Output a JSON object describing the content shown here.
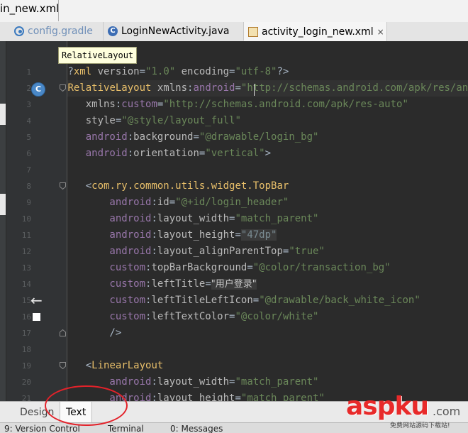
{
  "breadcrumb": {
    "file": "in_new.xml"
  },
  "tabs": [
    {
      "label": "config.gradle",
      "icon": "gradle-icon",
      "active": false
    },
    {
      "label": "LoginNewActivity.java",
      "icon": "java-class-icon",
      "icon_letter": "C",
      "active": false
    },
    {
      "label": "activity_login_new.xml",
      "icon": "xml-file-icon",
      "active": true,
      "close": "×"
    }
  ],
  "tooltip": "RelativeLayout",
  "gutter": {
    "class_marker": "C",
    "back_arrow": "←"
  },
  "lines": [
    {
      "n": "1",
      "segs": [
        [
          "punc",
          "<?"
        ],
        [
          "tag",
          "xml "
        ],
        [
          "attr",
          "version"
        ],
        [
          "punc",
          "="
        ],
        [
          "val",
          "\"1.0\""
        ],
        [
          "attr",
          " encoding"
        ],
        [
          "punc",
          "="
        ],
        [
          "val",
          "\"utf-8\""
        ],
        [
          "punc",
          "?>"
        ]
      ]
    },
    {
      "n": "2",
      "segs": [
        [
          "punc",
          "<"
        ],
        [
          "tag",
          "RelativeLayout "
        ],
        [
          "attr",
          "xmlns"
        ],
        [
          "punc",
          ":"
        ],
        [
          "ns",
          "android"
        ],
        [
          "punc",
          "="
        ],
        [
          "val",
          "\"http://schemas.android.com/apk/res/android\""
        ]
      ]
    },
    {
      "n": "3",
      "segs": [
        [
          "attr",
          "    xmlns"
        ],
        [
          "punc",
          ":"
        ],
        [
          "ns",
          "custom"
        ],
        [
          "punc",
          "="
        ],
        [
          "val",
          "\"http://schemas.android.com/apk/res-auto\""
        ]
      ]
    },
    {
      "n": "4",
      "segs": [
        [
          "attr",
          "    style"
        ],
        [
          "punc",
          "="
        ],
        [
          "val",
          "\"@style/layout_full\""
        ]
      ]
    },
    {
      "n": "5",
      "segs": [
        [
          "ns",
          "    android"
        ],
        [
          "punc",
          ":"
        ],
        [
          "attr",
          "background"
        ],
        [
          "punc",
          "="
        ],
        [
          "val",
          "\"@drawable/login_bg\""
        ]
      ]
    },
    {
      "n": "6",
      "segs": [
        [
          "ns",
          "    android"
        ],
        [
          "punc",
          ":"
        ],
        [
          "attr",
          "orientation"
        ],
        [
          "punc",
          "="
        ],
        [
          "val",
          "\"vertical\""
        ],
        [
          "punc",
          ">"
        ]
      ]
    },
    {
      "n": "7",
      "segs": []
    },
    {
      "n": "8",
      "segs": [
        [
          "punc",
          "    <"
        ],
        [
          "tag",
          "com.ry.common.utils.widget.TopBar"
        ]
      ]
    },
    {
      "n": "9",
      "segs": [
        [
          "ns",
          "        android"
        ],
        [
          "punc",
          ":"
        ],
        [
          "attr",
          "id"
        ],
        [
          "punc",
          "="
        ],
        [
          "val",
          "\"@+id/login_header\""
        ]
      ]
    },
    {
      "n": "10",
      "segs": [
        [
          "ns",
          "        android"
        ],
        [
          "punc",
          ":"
        ],
        [
          "attr",
          "layout_width"
        ],
        [
          "punc",
          "="
        ],
        [
          "val",
          "\"match_parent\""
        ]
      ]
    },
    {
      "n": "11",
      "segs": [
        [
          "ns",
          "        android"
        ],
        [
          "punc",
          ":"
        ],
        [
          "attr",
          "layout_height"
        ],
        [
          "punc",
          "="
        ],
        [
          "gray",
          "\"47dp\""
        ]
      ]
    },
    {
      "n": "12",
      "segs": [
        [
          "ns",
          "        android"
        ],
        [
          "punc",
          ":"
        ],
        [
          "attr",
          "layout_alignParentTop"
        ],
        [
          "punc",
          "="
        ],
        [
          "val",
          "\"true\""
        ]
      ]
    },
    {
      "n": "13",
      "segs": [
        [
          "ns",
          "        custom"
        ],
        [
          "punc",
          ":"
        ],
        [
          "attr",
          "topBarBackground"
        ],
        [
          "punc",
          "="
        ],
        [
          "val",
          "\"@color/transaction_bg\""
        ]
      ]
    },
    {
      "n": "14",
      "segs": [
        [
          "ns",
          "        custom"
        ],
        [
          "punc",
          ":"
        ],
        [
          "attr",
          "leftTitle"
        ],
        [
          "punc",
          "="
        ],
        [
          "zh",
          "\"用户登录\""
        ]
      ]
    },
    {
      "n": "15",
      "segs": [
        [
          "ns",
          "        custom"
        ],
        [
          "punc",
          ":"
        ],
        [
          "attr",
          "leftTitleLeftIcon"
        ],
        [
          "punc",
          "="
        ],
        [
          "val",
          "\"@drawable/back_white_icon\""
        ]
      ]
    },
    {
      "n": "16",
      "segs": [
        [
          "ns",
          "        custom"
        ],
        [
          "punc",
          ":"
        ],
        [
          "attr",
          "leftTextColor"
        ],
        [
          "punc",
          "="
        ],
        [
          "val",
          "\"@color/white\""
        ]
      ]
    },
    {
      "n": "17",
      "segs": [
        [
          "punc",
          "        />"
        ]
      ]
    },
    {
      "n": "18",
      "segs": []
    },
    {
      "n": "19",
      "segs": [
        [
          "punc",
          "    <"
        ],
        [
          "tag",
          "LinearLayout"
        ]
      ]
    },
    {
      "n": "20",
      "segs": [
        [
          "ns",
          "        android"
        ],
        [
          "punc",
          ":"
        ],
        [
          "attr",
          "layout_width"
        ],
        [
          "punc",
          "="
        ],
        [
          "val",
          "\"match_parent\""
        ]
      ]
    },
    {
      "n": "21",
      "segs": [
        [
          "ns",
          "        android"
        ],
        [
          "punc",
          ":"
        ],
        [
          "attr",
          "layout_height"
        ],
        [
          "punc",
          "="
        ],
        [
          "val",
          "\"match_parent\""
        ]
      ]
    }
  ],
  "editor_mode_tabs": [
    {
      "label": "Design",
      "active": false
    },
    {
      "label": "Text",
      "active": true
    }
  ],
  "status_bar": [
    {
      "label": "9: Version Control"
    },
    {
      "label": "Terminal"
    },
    {
      "label": "0: Messages"
    }
  ],
  "watermark": {
    "main": "aspku",
    "suffix": ".com",
    "sub": "免费网站源码下载站!"
  }
}
